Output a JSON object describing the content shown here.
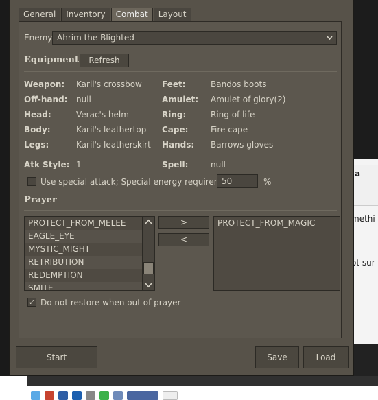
{
  "tabs": [
    "General",
    "Inventory",
    "Combat",
    "Layout"
  ],
  "enemy": {
    "label": "Enemy",
    "value": "Ahrim the Blighted"
  },
  "equipment": {
    "title": "Equipment",
    "refresh": "Refresh",
    "left": [
      {
        "label": "Weapon:",
        "value": "Karil's crossbow"
      },
      {
        "label": "Off-hand:",
        "value": "null"
      },
      {
        "label": "Head:",
        "value": "Verac's helm"
      },
      {
        "label": "Body:",
        "value": "Karil's leathertop"
      },
      {
        "label": "Legs:",
        "value": "Karil's leatherskirt"
      }
    ],
    "right": [
      {
        "label": "Feet:",
        "value": "Bandos boots"
      },
      {
        "label": "Amulet:",
        "value": "Amulet of glory(2)"
      },
      {
        "label": "Ring:",
        "value": "Ring of life"
      },
      {
        "label": "Cape:",
        "value": "Fire cape"
      },
      {
        "label": "Hands:",
        "value": "Barrows gloves"
      }
    ],
    "atk_style_label": "Atk Style:",
    "atk_style_value": "1",
    "spell_label": "Spell:",
    "spell_value": "null",
    "special_label": "Use special attack; Special energy requirement:",
    "special_value": "50",
    "special_unit": "%"
  },
  "prayer": {
    "title": "Prayer",
    "available": [
      "PROTECT_FROM_MELEE",
      "EAGLE_EYE",
      "MYSTIC_MIGHT",
      "RETRIBUTION",
      "REDEMPTION",
      "SMITE"
    ],
    "add": ">",
    "remove": "<",
    "selected": [
      "PROTECT_FROM_MAGIC"
    ],
    "restore_label": "Do not restore when out of prayer",
    "restore_checked": "✓"
  },
  "buttons": {
    "start": "Start",
    "save": "Save",
    "load": "Load"
  },
  "background": {
    "text1": "a",
    "text2": "methi",
    "text3": "ot sur"
  }
}
